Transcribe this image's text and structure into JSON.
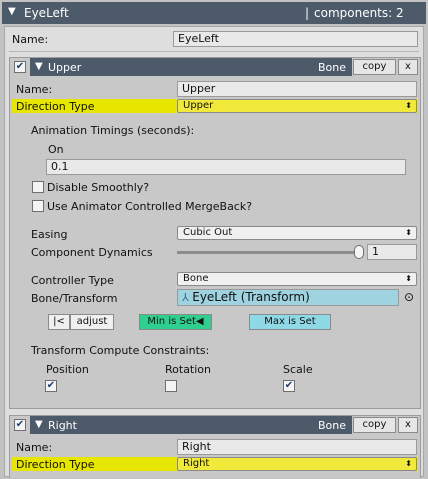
{
  "titlebar": {
    "title": "EyeLeft",
    "separator": "|",
    "components": "components: 2"
  },
  "name_label": "Name:",
  "name_value": "EyeLeft",
  "upper": {
    "header_title": "Upper",
    "header_type": "Bone",
    "copy_label": "copy",
    "close_label": "x",
    "name_label": "Name:",
    "name_value": "Upper",
    "direction_label": "Direction Type",
    "direction_value": "Upper",
    "anim_label": "Animation Timings (seconds):",
    "on_label": "On",
    "on_value": "0.1",
    "disable_smoothly": "Disable Smoothly?",
    "use_animator": "Use Animator Controlled MergeBack?",
    "easing_label": "Easing",
    "easing_value": "Cubic Out",
    "dynamics_label": "Component Dynamics",
    "dynamics_value": "1",
    "dynamics_fraction": 1.0,
    "controller_label": "Controller Type",
    "controller_value": "Bone",
    "bone_label": "Bone/Transform",
    "bone_value": "EyeLeft (Transform)",
    "btn_prev": "|<",
    "btn_adjust": "adjust",
    "btn_min": "Min is Set◀",
    "btn_max": "Max is Set",
    "constraints_label": "Transform Compute Constraints:",
    "position_label": "Position",
    "rotation_label": "Rotation",
    "scale_label": "Scale",
    "position_checked": true,
    "rotation_checked": false,
    "scale_checked": true
  },
  "right": {
    "header_title": "Right",
    "header_type": "Bone",
    "copy_label": "copy",
    "close_label": "x",
    "name_label": "Name:",
    "name_value": "Right",
    "direction_label": "Direction Type",
    "direction_value": "Right"
  },
  "icons": {
    "collapse": "▼",
    "check": "✔",
    "dropdown": "⬍",
    "target": "⊙",
    "bone": "⅄"
  },
  "colors": {
    "header_bg": "#4d5a6a",
    "highlight": "#e6e600",
    "min_btn": "#2ecf8f",
    "max_btn": "#8fd9e6",
    "bone_field": "#9fd3e0"
  }
}
